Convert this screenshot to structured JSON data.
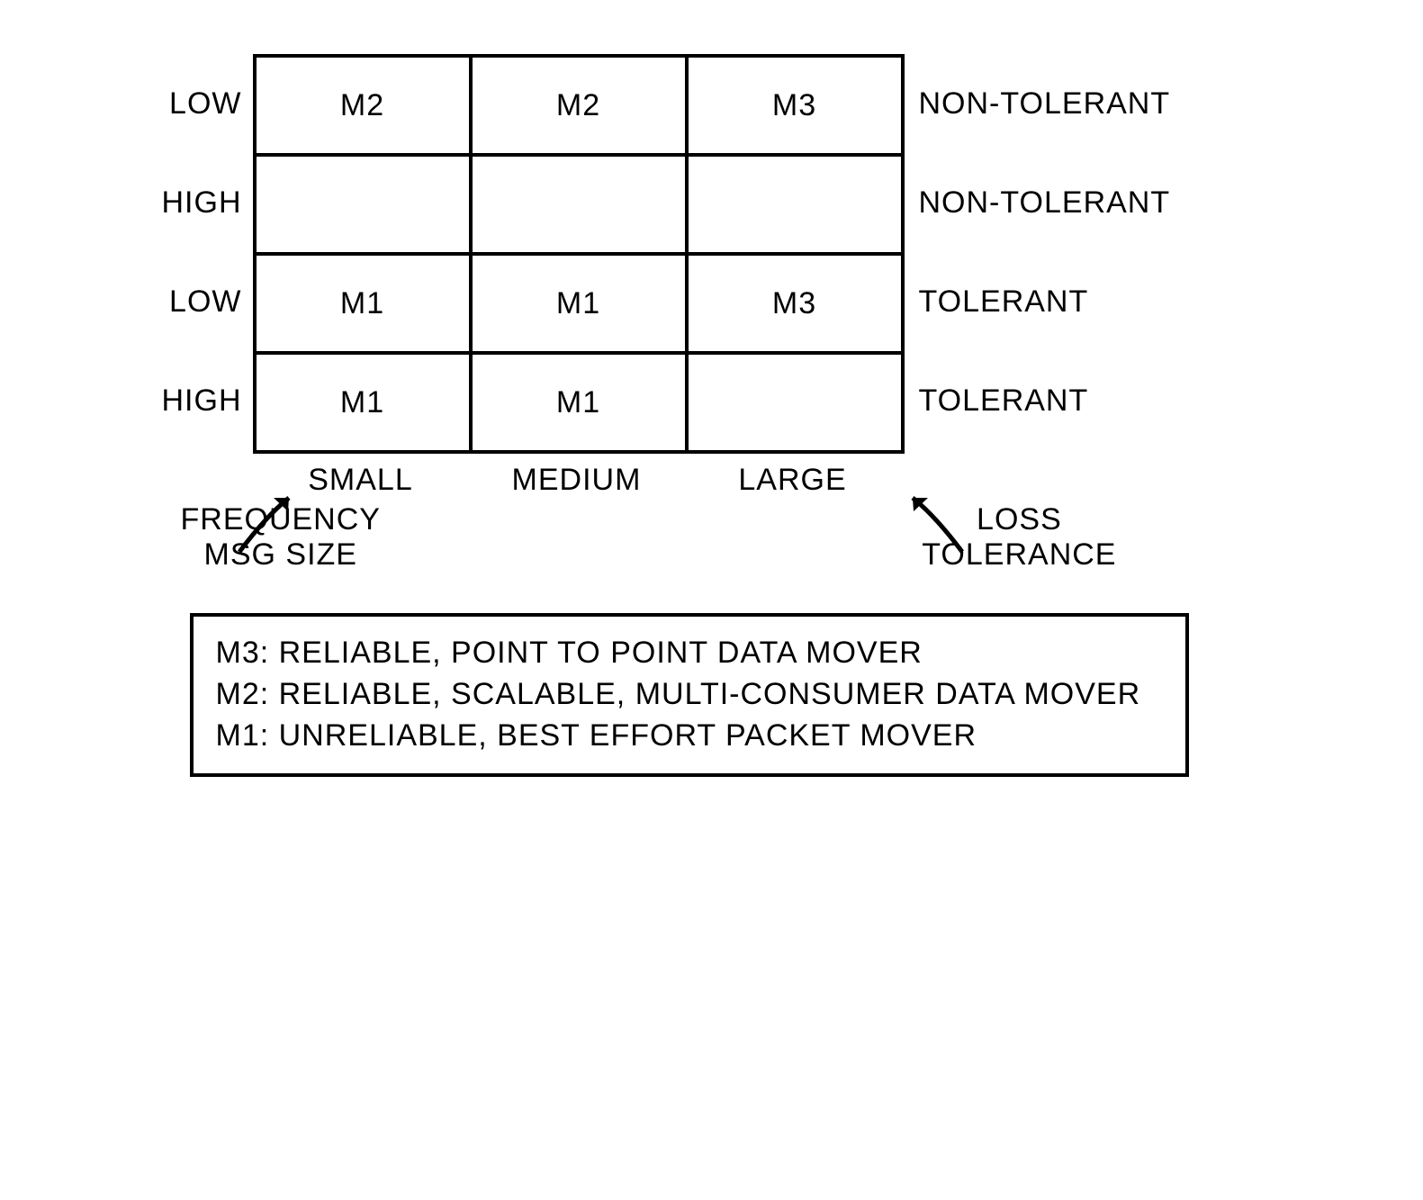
{
  "chart_data": {
    "type": "table",
    "title": "",
    "row_axis_left": "FREQUENCY",
    "row_axis_left2": "MSG SIZE",
    "row_axis_right": "LOSS",
    "row_axis_right2": "TOLERANCE",
    "column_headers": [
      "SMALL",
      "MEDIUM",
      "LARGE"
    ],
    "rows": [
      {
        "left": "LOW",
        "right": "NON-TOLERANT",
        "cells": [
          "M2",
          "M2",
          "M3"
        ]
      },
      {
        "left": "HIGH",
        "right": "NON-TOLERANT",
        "cells": [
          "",
          "",
          ""
        ]
      },
      {
        "left": "LOW",
        "right": "TOLERANT",
        "cells": [
          "M1",
          "M1",
          "M3"
        ]
      },
      {
        "left": "HIGH",
        "right": "TOLERANT",
        "cells": [
          "M1",
          "M1",
          ""
        ]
      }
    ]
  },
  "legend": [
    "M3: RELIABLE, POINT TO POINT DATA MOVER",
    "M2: RELIABLE, SCALABLE, MULTI-CONSUMER DATA MOVER",
    "M1: UNRELIABLE, BEST EFFORT PACKET MOVER"
  ],
  "axis_left_line1": "FREQUENCY",
  "axis_left_line2": "MSG SIZE",
  "axis_right_line1": "LOSS",
  "axis_right_line2": "TOLERANCE"
}
